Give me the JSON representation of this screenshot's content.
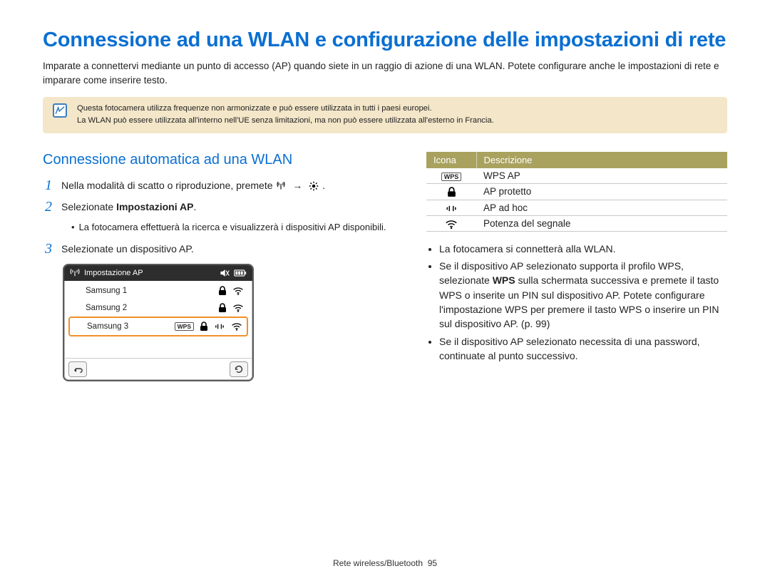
{
  "title": "Connessione ad una WLAN e configurazione delle impostazioni di rete",
  "intro": "Imparate a connettervi mediante un punto di accesso (AP) quando siete in un raggio di azione di una WLAN. Potete configurare anche le impostazioni di rete e imparare come inserire testo.",
  "note": {
    "line1": "Questa fotocamera utilizza frequenze non armonizzate e può essere utilizzata in tutti i paesi europei.",
    "line2": "La WLAN può essere utilizzata all'interno nell'UE senza limitazioni, ma non può essere utilizzata all'esterno in Francia."
  },
  "section_title": "Connessione automatica ad una WLAN",
  "steps": {
    "s1": {
      "num": "1",
      "pre": "Nella modalità di scatto o riproduzione, premete ",
      "arrow": "→",
      "post": "."
    },
    "s2": {
      "num": "2",
      "text_a": "Selezionate ",
      "text_b": "Impostazioni AP",
      "text_c": ".",
      "bullet": "La fotocamera effettuerà la ricerca e visualizzerà i dispositivi AP disponibili."
    },
    "s3": {
      "num": "3",
      "text": "Selezionate un dispositivo AP."
    }
  },
  "device": {
    "title": "Impostazione AP",
    "rows": [
      "Samsung 1",
      "Samsung 2",
      "Samsung 3"
    ],
    "wps": "WPS"
  },
  "table": {
    "h1": "Icona",
    "h2": "Descrizione",
    "rows": [
      {
        "icon": "WPS",
        "desc": "WPS AP"
      },
      {
        "icon": "lock",
        "desc": "AP protetto"
      },
      {
        "icon": "adhoc",
        "desc": "AP ad hoc"
      },
      {
        "icon": "signal",
        "desc": "Potenza del segnale"
      }
    ]
  },
  "right_bullets": {
    "b1": "La fotocamera si connetterà alla WLAN.",
    "b2a": "Se il dispositivo AP selezionato supporta il profilo WPS, selezionate ",
    "b2b": "WPS",
    "b2c": " sulla schermata successiva e premete il tasto WPS o inserite un PIN sul dispositivo AP. Potete configurare l'impostazione WPS per premere il tasto WPS o inserire un PIN sul dispositivo AP. (p. 99)",
    "b3": "Se il dispositivo AP selezionato necessita di una password, continuate al punto successivo."
  },
  "footer": {
    "label": "Rete wireless/Bluetooth",
    "page": "95"
  }
}
